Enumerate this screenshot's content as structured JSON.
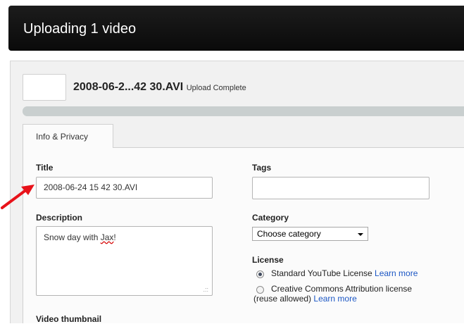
{
  "header": {
    "title": "Uploading 1 video"
  },
  "upload": {
    "filename": "2008-06-2...42 30.AVI",
    "status": "Upload Complete",
    "progress_percent": 100
  },
  "tabs": [
    {
      "label": "Info & Privacy"
    }
  ],
  "form": {
    "title_label": "Title",
    "title_value": "2008-06-24 15 42 30.AVI",
    "description_label": "Description",
    "description_value_plain": "Snow day with ",
    "description_value_misspelled": "Jax",
    "description_value_end": "!",
    "tags_label": "Tags",
    "tags_value": "",
    "category_label": "Category",
    "category_selected": "Choose category",
    "license_label": "License",
    "license_option_1": "Standard YouTube License",
    "license_option_1_link": "Learn more",
    "license_option_2_line1": "Creative Commons Attribution license",
    "license_option_2_line2": "(reuse allowed)",
    "license_option_2_link": "Learn more",
    "thumbnail_label": "Video thumbnail"
  },
  "colors": {
    "header_bg": "#111111",
    "link": "#1c57c4",
    "annotation_arrow": "#e8121a"
  },
  "icons": [
    "resize-grip-icon",
    "dropdown-caret-icon",
    "annotation-arrow-icon"
  ]
}
